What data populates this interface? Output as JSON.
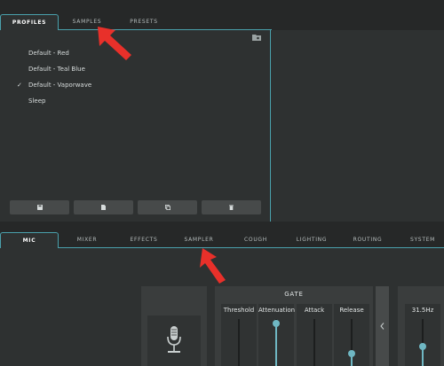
{
  "top_tabs": [
    {
      "label": "PROFILES",
      "active": true
    },
    {
      "label": "SAMPLES",
      "active": false
    },
    {
      "label": "PRESETS",
      "active": false
    }
  ],
  "profiles": [
    {
      "label": "Default - Red",
      "checked": false
    },
    {
      "label": "Default - Teal Blue",
      "checked": false
    },
    {
      "label": "Default - Vaporwave",
      "checked": true
    },
    {
      "label": "Sleep",
      "checked": false
    }
  ],
  "profile_actions": [
    "save-icon",
    "new-file-icon",
    "duplicate-icon",
    "delete-icon"
  ],
  "bottom_tabs": [
    {
      "label": "MIC",
      "active": true
    },
    {
      "label": "MIXER",
      "active": false
    },
    {
      "label": "EFFECTS",
      "active": false
    },
    {
      "label": "SAMPLER",
      "active": false
    },
    {
      "label": "COUGH",
      "active": false
    },
    {
      "label": "LIGHTING",
      "active": false
    },
    {
      "label": "ROUTING",
      "active": false
    },
    {
      "label": "SYSTEM",
      "active": false
    }
  ],
  "gate": {
    "title": "GATE",
    "threshold_label": "Threshold",
    "attenuation_label": "Attenuation",
    "attack_label": "Attack",
    "release_label": "Release"
  },
  "eq": {
    "band_label": "31.5Hz"
  },
  "colors": {
    "accent": "#4aa0ac",
    "slider": "#6fb7c3",
    "arrow": "#e8302a"
  }
}
